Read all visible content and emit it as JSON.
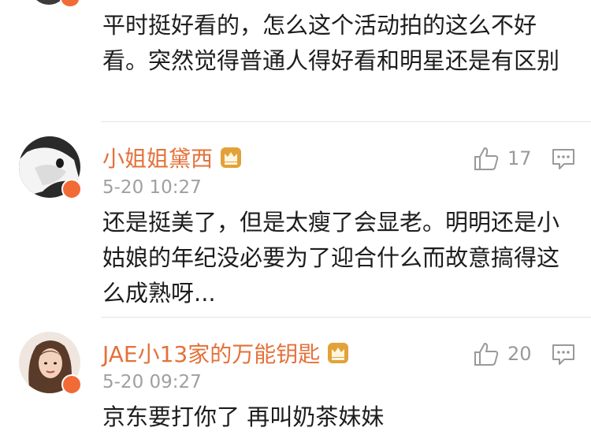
{
  "colors": {
    "username": "#e4713a",
    "badge": "#f26a36",
    "crown": "#e2a23a",
    "meta": "#a0a0a0",
    "icon": "#999999"
  },
  "comments": [
    {
      "text": "平时挺好看的，怎么这个活动拍的这么不好看。突然觉得普通人得好看和明星还是有区别"
    },
    {
      "username": "小姐姐黛西",
      "timestamp": "5-20 10:27",
      "likes": "17",
      "text": "还是挺美了，但是太瘦了会显老。明明还是小姑娘的年纪没必要为了迎合什么而故意搞得这么成熟呀..."
    },
    {
      "username": "JAE小13家的万能钥匙",
      "timestamp": "5-20 09:27",
      "likes": "20",
      "text": "京东要打你了 再叫奶茶妹妹"
    }
  ],
  "icons": {
    "like": "thumbs-up-icon",
    "reply": "comment-icon",
    "crown": "crown-icon",
    "verified": "verified-badge-icon"
  }
}
